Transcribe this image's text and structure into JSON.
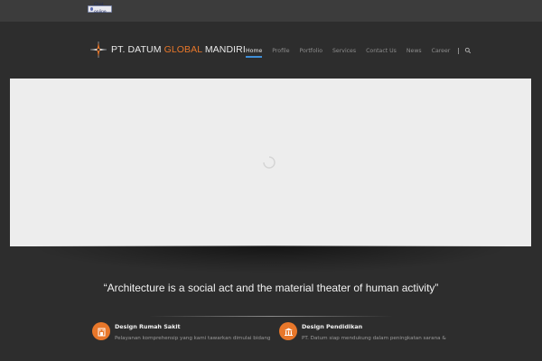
{
  "topbar": {
    "status_badge": "Chat online"
  },
  "logo": {
    "part1": "PT. DATUM ",
    "part2": "GLOBAL",
    "part3": " MANDIRI"
  },
  "nav": {
    "items": [
      {
        "label": "Home",
        "active": true
      },
      {
        "label": "Profile"
      },
      {
        "label": "Portfolio"
      },
      {
        "label": "Services"
      },
      {
        "label": "Contact Us"
      },
      {
        "label": "News"
      },
      {
        "label": "Career"
      }
    ],
    "search_icon": "search-icon"
  },
  "quote": "“Architecture is a social act and the material theater of human activity”",
  "services": [
    {
      "title": "Design Rumah Sakit",
      "text": "Pelayanan komprehensip yang kami tawarkan dimulai bidang",
      "icon": "building-icon"
    },
    {
      "title": "Design Pendidikan",
      "text": "PT. Datum siap mendukung dalam peningkatan sarana &",
      "icon": "school-icon"
    }
  ],
  "colors": {
    "accent": "#e8772a",
    "nav_active_underline": "#3f8fd8",
    "background": "#2d2d2d"
  }
}
